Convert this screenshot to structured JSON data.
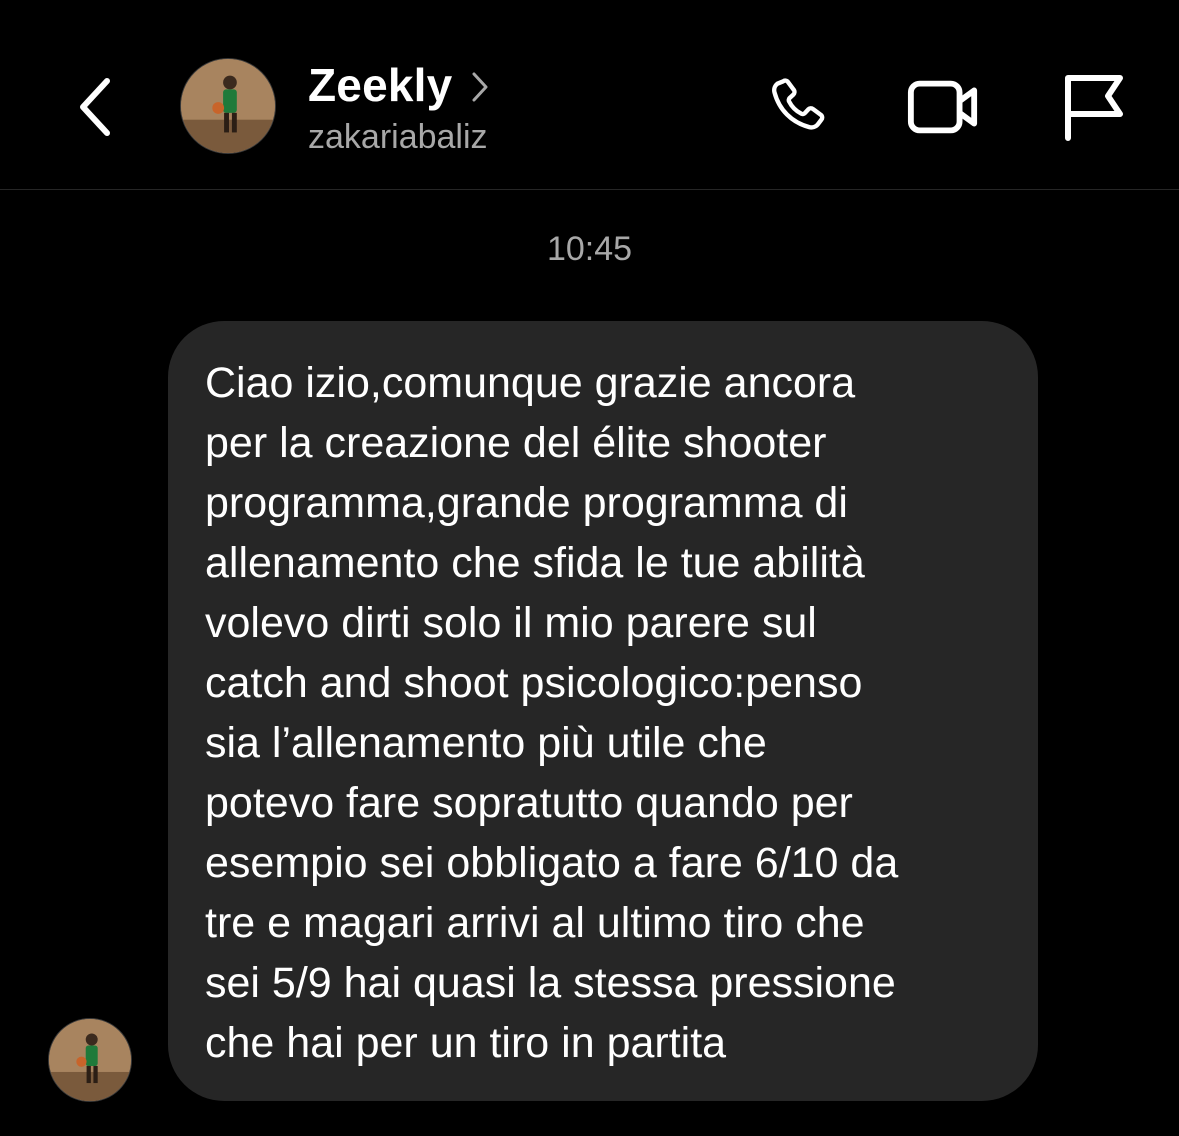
{
  "header": {
    "contact_name": "Zeekly",
    "username": "zakariabaliz",
    "icons": [
      "back-chevron-icon",
      "avatar",
      "chevron-right-icon",
      "phone-icon",
      "video-camera-icon",
      "flag-icon"
    ]
  },
  "conversation": {
    "timestamp": "10:45",
    "messages": [
      {
        "sender": "Zeekly",
        "text": "Ciao izio,comunque grazie ancora\nper la creazione del élite shooter\nprogramma,grande programma di\nallenamento che sfida le tue abilità\nvolevo dirti solo il mio parere sul\ncatch and shoot psicologico:penso\nsia l’allenamento più utile che\npotevo fare sopratutto quando per\nesempio sei obbligato a fare 6/10 da\ntre e magari arrivi al ultimo tiro che\nsei 5/9 hai quasi la stessa pressione\nche hai per un tiro in partita"
      }
    ]
  },
  "colors": {
    "background": "#000000",
    "bubble": "#262626",
    "text_primary": "#ffffff",
    "text_secondary": "#a8a8a8",
    "divider": "#262626"
  }
}
